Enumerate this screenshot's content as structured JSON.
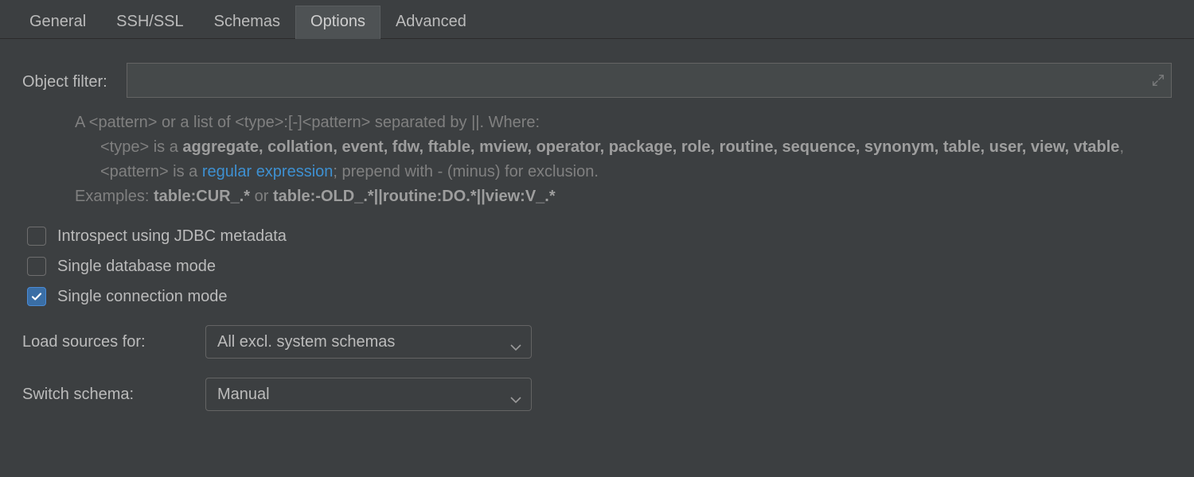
{
  "tabs": [
    {
      "label": "General",
      "active": false
    },
    {
      "label": "SSH/SSL",
      "active": false
    },
    {
      "label": "Schemas",
      "active": false
    },
    {
      "label": "Options",
      "active": true
    },
    {
      "label": "Advanced",
      "active": false
    }
  ],
  "object_filter": {
    "label": "Object filter:",
    "value": ""
  },
  "help": {
    "line1_prefix": "A <pattern> or a list of <type>:[-]<pattern> separated by ||. Where:",
    "type_prefix": "<type> is a ",
    "type_keywords": "aggregate, collation, event, fdw, ftable, mview, operator, package, role, routine, sequence, synonym, table, user, view, vtable",
    "type_trail": ",",
    "pattern_prefix": "<pattern> is a ",
    "pattern_link": "regular expression",
    "pattern_suffix": "; prepend with - (minus) for exclusion.",
    "examples_label": "Examples: ",
    "example1": "table:CUR_.*",
    "examples_or": " or ",
    "example2": "table:-OLD_.*||routine:DO.*||view:V_.*"
  },
  "checkboxes": {
    "introspect_jdbc": {
      "label": "Introspect using JDBC metadata",
      "checked": false
    },
    "single_db": {
      "label": "Single database mode",
      "checked": false
    },
    "single_conn": {
      "label": "Single connection mode",
      "checked": true
    }
  },
  "selects": {
    "load_sources": {
      "label": "Load sources for:",
      "value": "All excl. system schemas"
    },
    "switch_schema": {
      "label": "Switch schema:",
      "value": "Manual"
    }
  }
}
